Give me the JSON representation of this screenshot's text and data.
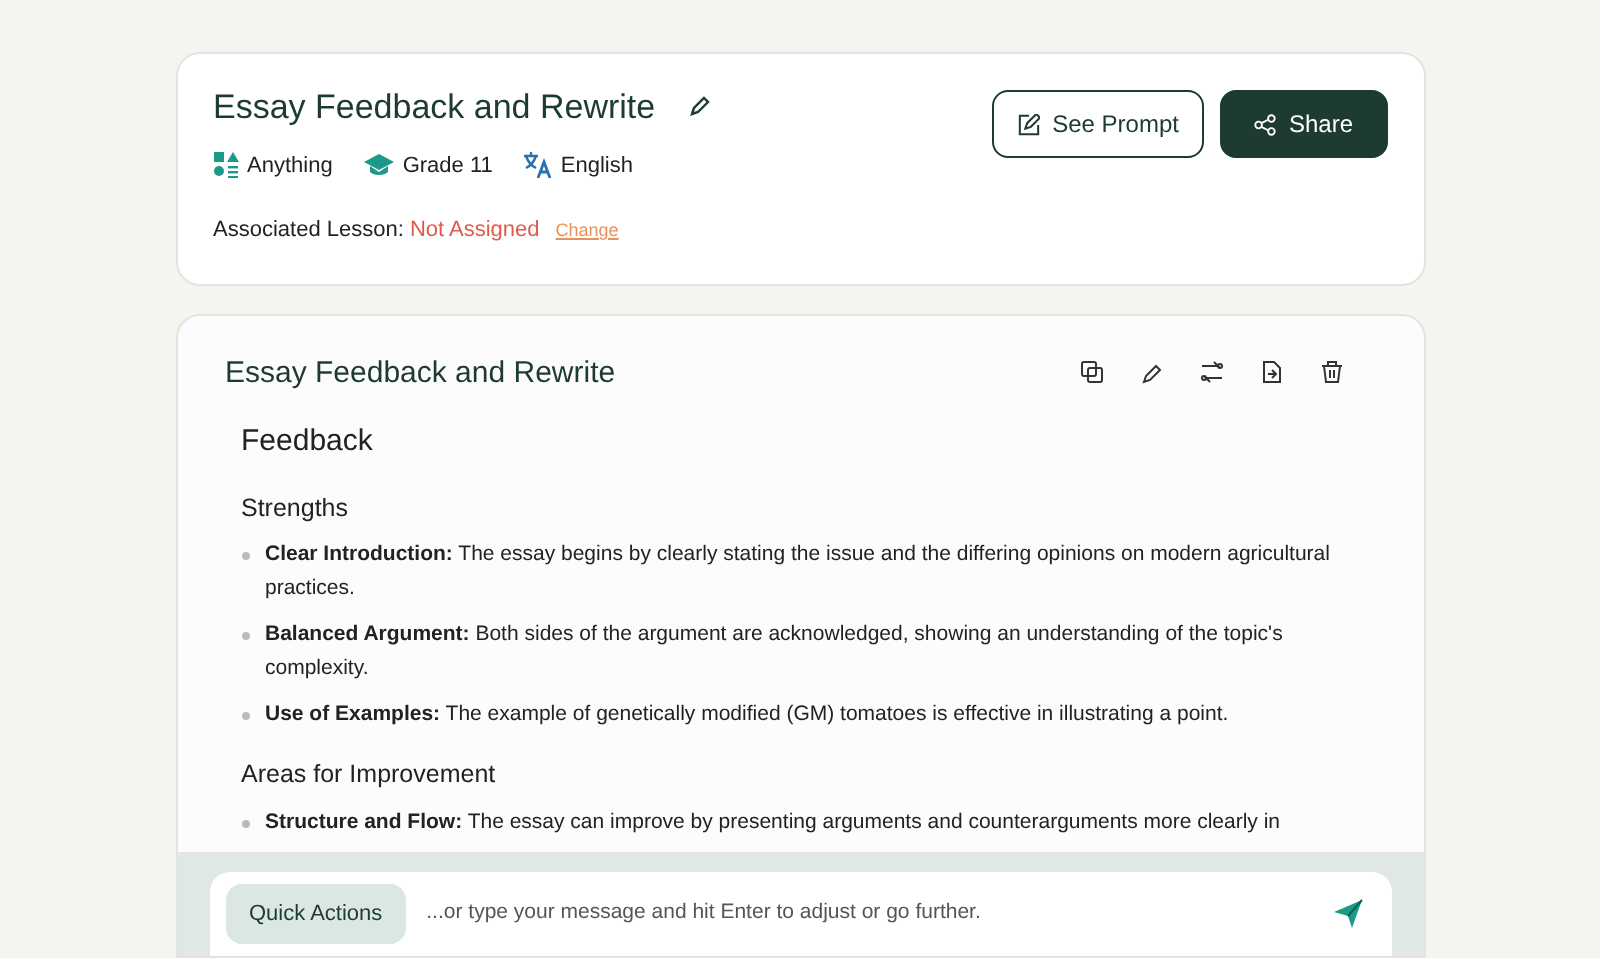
{
  "header": {
    "title": "Essay Feedback and Rewrite",
    "tags": [
      {
        "kind": "subject",
        "label": "Anything"
      },
      {
        "kind": "grade",
        "label": "Grade 11"
      },
      {
        "kind": "language",
        "label": "English"
      }
    ],
    "lesson_label": "Associated Lesson:",
    "lesson_value": "Not Assigned",
    "change_link": "Change",
    "buttons": [
      {
        "kind": "outline",
        "label": "See Prompt"
      },
      {
        "kind": "solid",
        "label": "Share"
      }
    ]
  },
  "result": {
    "title": "Essay Feedback and Rewrite",
    "heading": "Feedback",
    "sections": [
      {
        "title": "Strengths",
        "items": [
          "**Clear Introduction:** The essay begins by clearly stating the issue and the differing opinions on modern agricultural practices.",
          "**Balanced Argument:** Both sides of the argument are acknowledged, showing an understanding of the topic's complexity.",
          "**Use of Examples:** The example of genetically modified (GM) tomatoes is effective in illustrating a point."
        ]
      },
      {
        "title": "Areas for Improvement",
        "items": [
          "**Structure and Flow:** The essay can improve by presenting arguments and counterarguments more clearly in"
        ]
      }
    ]
  },
  "chat": {
    "quick_actions": "Quick Actions",
    "placeholder": "...or type your message and hit Enter to adjust or go further."
  }
}
